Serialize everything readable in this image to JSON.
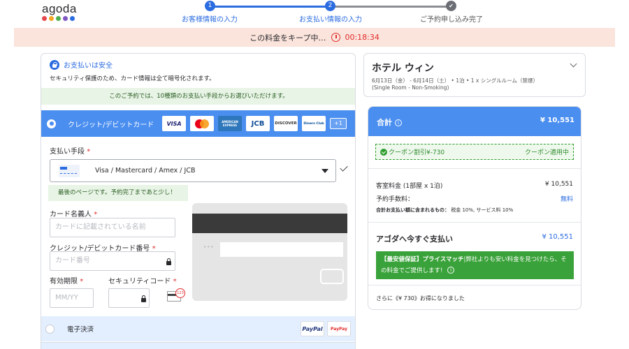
{
  "brand": {
    "logo_text": "agoda",
    "dot_colors": [
      "#e5484d",
      "#f5a623",
      "#4caf50",
      "#7e57c2",
      "#2b6ce0"
    ]
  },
  "steps": [
    {
      "number": "1",
      "label": "お客様情報の入力",
      "state": "done"
    },
    {
      "number": "2",
      "label": "お支払い情報の入力",
      "state": "current"
    },
    {
      "number": "✔",
      "label": "ご予約申し込み完了",
      "state": "pending"
    }
  ],
  "timer_bar": {
    "text": "この料金をキープ中…",
    "time": "00:18:34"
  },
  "payment": {
    "secure_title": "お支払いは安全",
    "secure_desc": "セキュリティ保護のため、カード情報は全て暗号化されます。",
    "methods_note": "このご予約では、10種類のお支払い手段からお選びいただけます。",
    "credit_card": {
      "title": "クレジット/デビットカード",
      "logos": [
        "VISA",
        "Mastercard",
        "AMERICAN EXPRESS",
        "JCB",
        "DISCOVER",
        "Diners Club"
      ],
      "more": "+1",
      "method_label": "支払い手段",
      "method_value": "Visa / Mastercard / Amex / JCB",
      "last_page_note": "最後のページです。予約完了まであと少し！",
      "holder_label": "カード名義人",
      "holder_placeholder": "カードに記載されている名前",
      "number_label": "クレジット/デビットカード番号",
      "number_placeholder": "カード番号",
      "expiry_label": "有効期限",
      "expiry_placeholder": "MM/YY",
      "cvv_label": "セキュリティコード",
      "cvv_badge": "123",
      "required_mark": "*"
    },
    "epay": {
      "title": "電子決済",
      "logos": [
        "PayPal",
        "PayPay"
      ]
    }
  },
  "hotel": {
    "name": "ホテル ウィン",
    "detail": "6月13日（金） - 6月14日（土） • 1泊 • 1 x シングルルーム（禁煙）",
    "room_en": "(Single Room - Non-Smoking)"
  },
  "price": {
    "total_label": "合計",
    "total_value": "¥ 10,551",
    "coupon_text": "クーポン割引¥-730",
    "coupon_status": "クーポン適用中",
    "room_label": "客室料金 (1部屋 x 1泊)",
    "room_value": "¥ 10,551",
    "fee_label": "予約手数料：",
    "fee_value": "無料",
    "tax_label": "合計お支払い額に含まれるもの：",
    "tax_value": "税金 10%, サービス料 10%",
    "pay_now_label": "アゴダへ今すぐ支払い",
    "pay_now_value": "¥ 10,551",
    "match_title": "【最安値保証】プライスマッチ",
    "match_text": "|弊社よりも安い料金を見つけたら、その料金でご提供します!",
    "saved_text": "さらに《¥ 730》お得になりました"
  }
}
